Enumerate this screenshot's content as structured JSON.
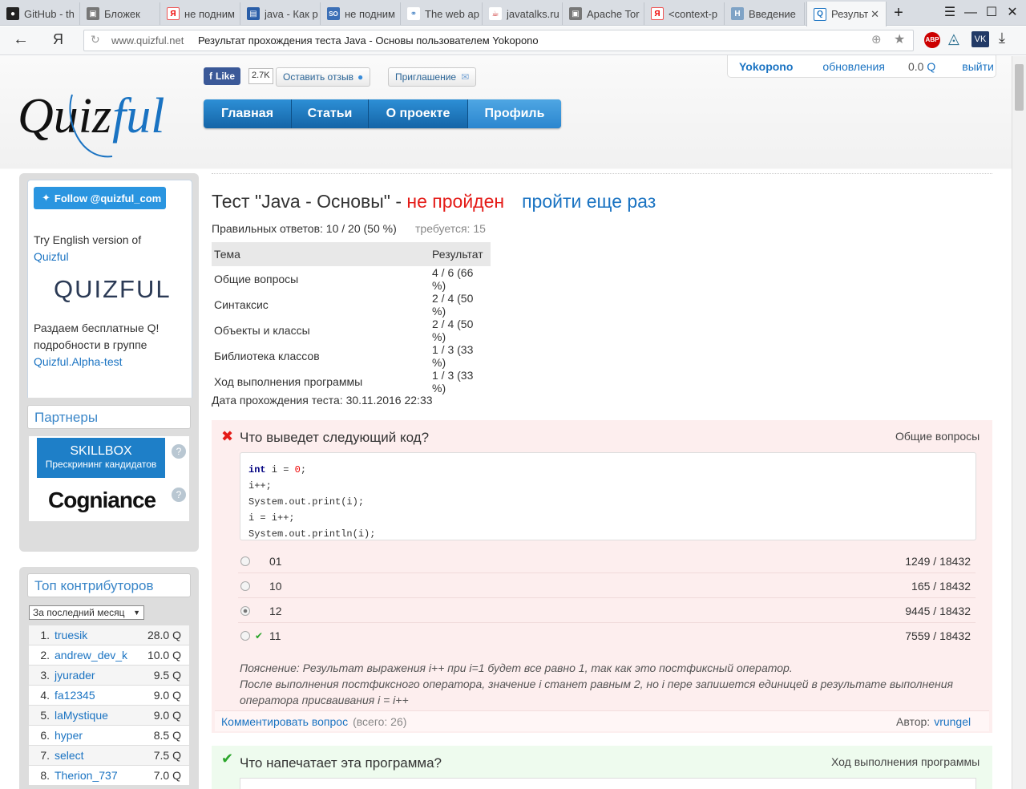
{
  "browser": {
    "tabs": [
      {
        "label": "GitHub - th",
        "icon": "github-icon"
      },
      {
        "label": "Бложек",
        "icon": "page-icon"
      },
      {
        "label": "не подним",
        "icon": "yandex-icon"
      },
      {
        "label": "java - Как р",
        "icon": "page-icon"
      },
      {
        "label": "не подним",
        "icon": "stackoverflow-icon"
      },
      {
        "label": "The web ap",
        "icon": "share-icon"
      },
      {
        "label": "javatalks.ru",
        "icon": "java-icon"
      },
      {
        "label": "Apache Tor",
        "icon": "page-icon"
      },
      {
        "label": "<context-p",
        "icon": "yandex-icon"
      },
      {
        "label": "Введение",
        "icon": "habr-icon"
      },
      {
        "label": "Результ",
        "icon": "quizful-icon"
      }
    ],
    "domain": "www.quizful.net",
    "page_title": "Результат прохождения теста Java - Основы пользователем Yokopono",
    "search_engine_glyph": "Я"
  },
  "header": {
    "like_label": "Like",
    "like_count": "2.7K",
    "feedback_label": "Оставить отзыв",
    "invite_label": "Приглашение",
    "nav": [
      "Главная",
      "Статьи",
      "О проекте",
      "Профиль"
    ],
    "user": {
      "name": "Yokopono",
      "updates": "обновления",
      "score": "0.0",
      "score_unit": "Q",
      "logout": "выйти"
    }
  },
  "sidebar": {
    "follow_label": "Follow @quizful_com",
    "english_prefix": "Try English version of",
    "english_link": "Quizful",
    "quizful_logo": "QUIZFUL",
    "promo_line1": "Раздаем бесплатные Q!",
    "promo_line2": "подробности в группе",
    "promo_link": "Quizful.Alpha-test",
    "partners_title": "Партнеры",
    "skillbox_title": "SKILLBOX",
    "skillbox_sub": "Прескрининг кандидатов",
    "cogniance": "Cogniance",
    "help_glyph": "?",
    "contrib_title": "Топ контрибуторов",
    "period": "За последний месяц",
    "contributors": [
      {
        "rank": "1.",
        "name": "truesik",
        "score": "28.0 Q"
      },
      {
        "rank": "2.",
        "name": "andrew_dev_k",
        "score": "10.0 Q"
      },
      {
        "rank": "3.",
        "name": "jyurader",
        "score": "9.5 Q"
      },
      {
        "rank": "4.",
        "name": "fa12345",
        "score": "9.0 Q"
      },
      {
        "rank": "5.",
        "name": "laMystique",
        "score": "9.0 Q"
      },
      {
        "rank": "6.",
        "name": "hyper",
        "score": "8.5 Q"
      },
      {
        "rank": "7.",
        "name": "select",
        "score": "7.5 Q"
      },
      {
        "rank": "8.",
        "name": "Therion_737",
        "score": "7.0 Q"
      }
    ]
  },
  "result": {
    "title_prefix": "Тест \"Java - Основы\" - ",
    "status": "не пройден",
    "retry": "пройти еще раз",
    "correct_label": "Правильных ответов: 10 / 20 (50 %)",
    "required_label": "требуется: 15",
    "table_headers": [
      "Тема",
      "Результат"
    ],
    "topics": [
      {
        "topic": "Общие вопросы",
        "result": "4 / 6 (66 %)"
      },
      {
        "topic": "Синтаксис",
        "result": "2 / 4 (50 %)"
      },
      {
        "topic": "Объекты и классы",
        "result": "2 / 4 (50 %)"
      },
      {
        "topic": "Библиотека классов",
        "result": "1 / 3 (33 %)"
      },
      {
        "topic": "Ход выполнения программы",
        "result": "1 / 3 (33 %)"
      }
    ],
    "date_label": "Дата прохождения теста: 30.11.2016 22:33"
  },
  "question1": {
    "title": "Что выведет следующий код?",
    "category": "Общие вопросы",
    "code": {
      "kw": "int",
      "var": " i = ",
      "num": "0",
      "end": ";",
      "lines": [
        "i++;",
        "System.out.print(i);",
        "i = i++;",
        "System.out.println(i);"
      ]
    },
    "answers": [
      {
        "label": "01",
        "stats": "1249 / 18432",
        "mark": ""
      },
      {
        "label": "10",
        "stats": "165 / 18432",
        "mark": ""
      },
      {
        "label": "12",
        "stats": "9445 / 18432",
        "mark": ""
      },
      {
        "label": "11",
        "stats": "7559 / 18432",
        "mark": "✔"
      }
    ],
    "explanation": [
      "Пояснение: Результат выражения i++ при i=1 будет все равно 1, так как это постфиксный оператор.",
      "После выполнения постфиксного оператора, значение i станет равным 2, но i пере запишется единицей в результате выполнения",
      "оператора присваивания i = i++"
    ],
    "comment_label": "Комментировать вопрос",
    "comment_count": "(всего: 26)",
    "author_label": "Автор:",
    "author": "vrungel"
  },
  "question2": {
    "title": "Что напечатает эта программа?",
    "category": "Ход выполнения программы"
  },
  "colors": {
    "accent": "#1a73c2",
    "fail": "#e41b17",
    "nav": "#1d75bd",
    "wrong_bg": "#fdeeee",
    "right_bg": "#eefbee"
  }
}
